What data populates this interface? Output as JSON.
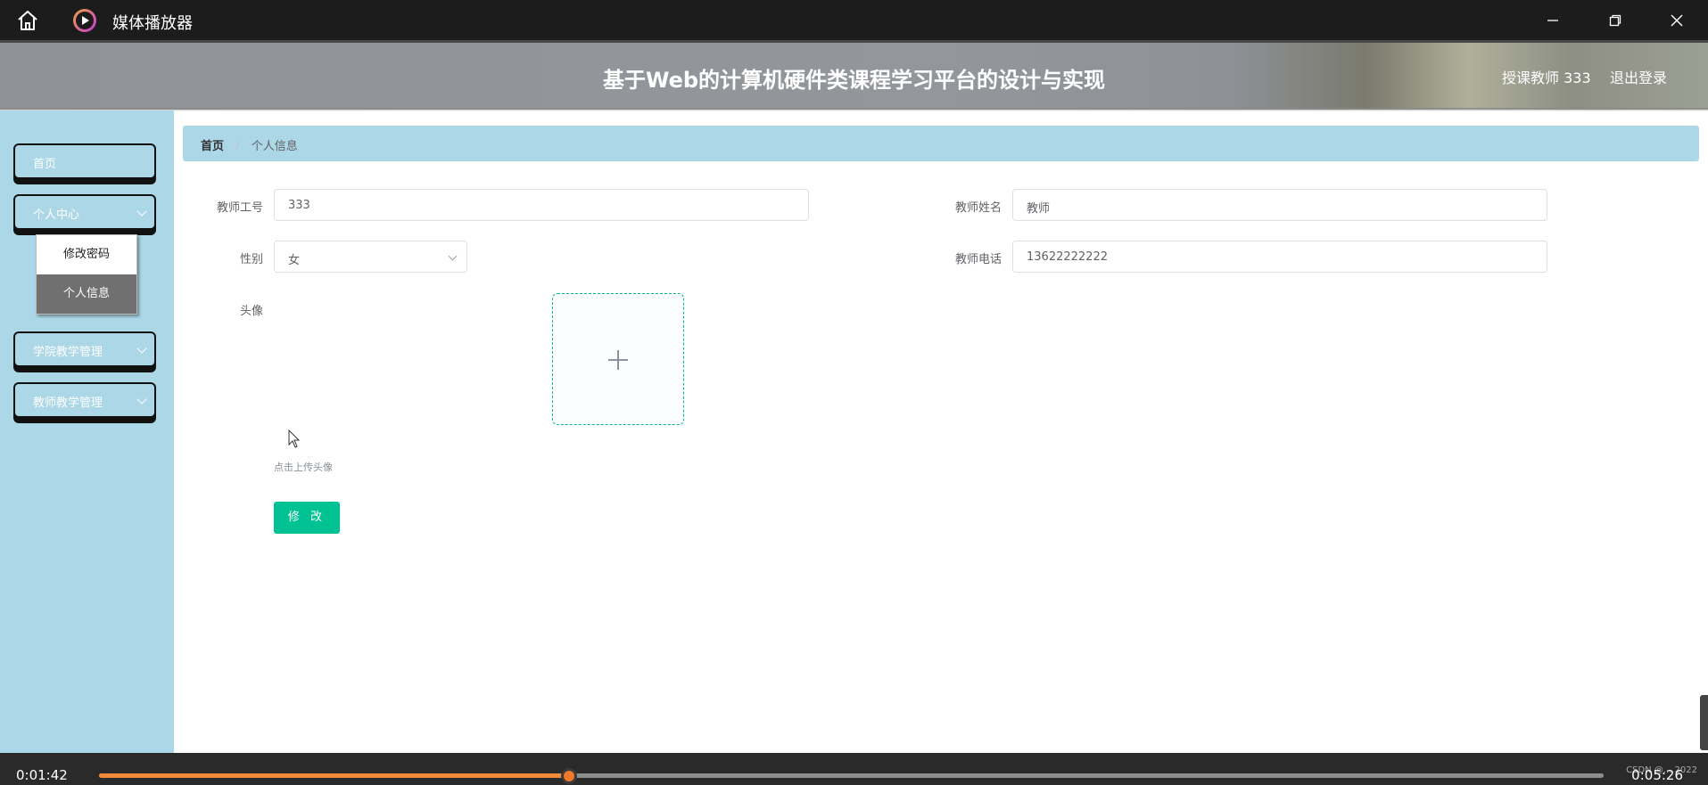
{
  "window": {
    "app_title": "媒体播放器",
    "home_icon": "home-icon",
    "logo_icon": "play-circle-icon",
    "controls": [
      "minimize-icon",
      "restore-icon",
      "close-icon"
    ]
  },
  "header": {
    "site_title": "基于Web的计算机硬件类课程学习平台的设计与实现",
    "user_role": "授课教师 333",
    "logout": "退出登录"
  },
  "sidebar": {
    "items": [
      {
        "label": "首页"
      },
      {
        "label": "个人中心"
      },
      {
        "label": "学院教学管理"
      },
      {
        "label": "教师教学管理"
      }
    ],
    "submenu": [
      {
        "label": "修改密码"
      },
      {
        "label": "个人信息"
      }
    ]
  },
  "breadcrumb": {
    "home": "首页",
    "separator": "/",
    "current": "个人信息"
  },
  "form": {
    "teacher_id": {
      "label": "教师工号",
      "value": "333"
    },
    "teacher_name": {
      "label": "教师姓名",
      "value": "教师"
    },
    "gender": {
      "label": "性别",
      "value": "女"
    },
    "teacher_phone": {
      "label": "教师电话",
      "value": "13622222222"
    },
    "avatar": {
      "label": "头像",
      "tip": "点击上传头像"
    },
    "submit": "修 改"
  },
  "player": {
    "current_time": "0:01:42",
    "total_time": "0:05:26",
    "progress": 0.3125,
    "watermark": "CSDN @... 2022"
  },
  "colors": {
    "sidebar_bg": "#acd7e6",
    "primary_button": "#00c292",
    "progress": "#f08a3a"
  }
}
